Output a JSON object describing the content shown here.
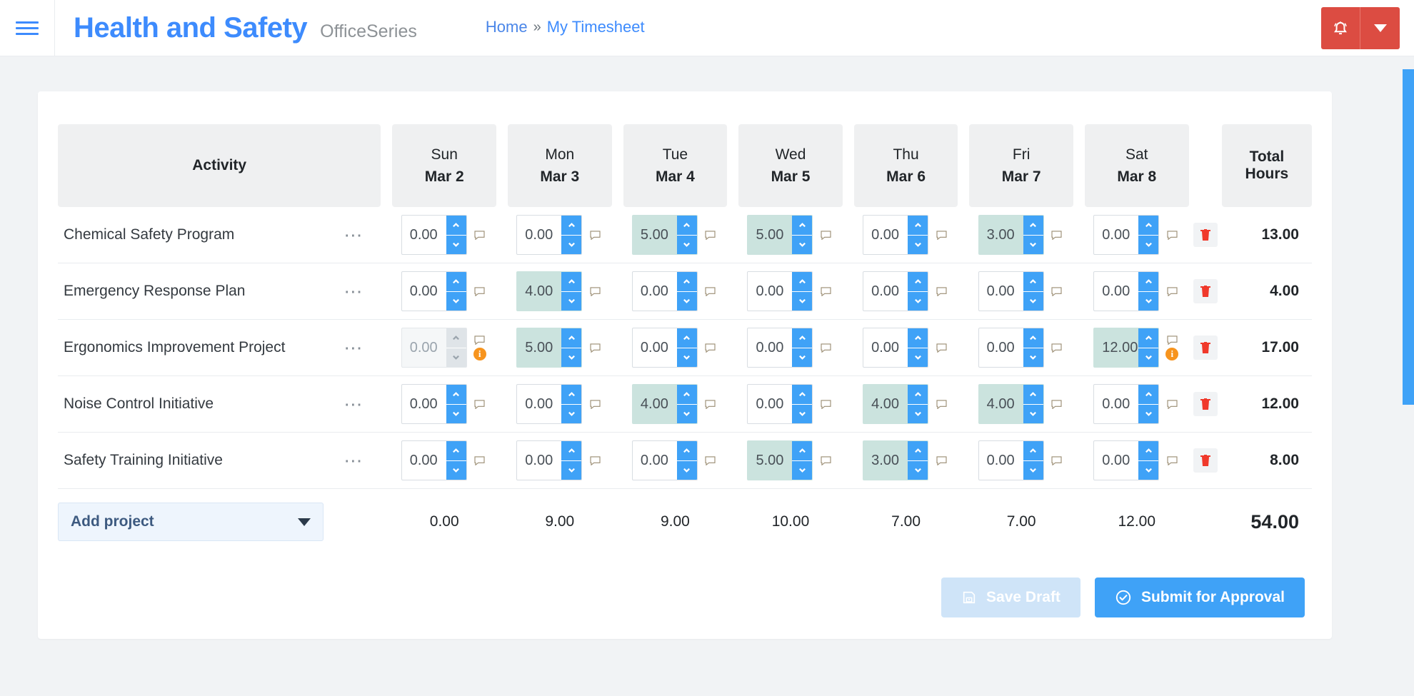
{
  "topbar": {
    "menu_icon": "hamburger-icon",
    "brand_title": "Health and Safety",
    "brand_subtitle": "OfficeSeries",
    "breadcrumb": {
      "home": "Home",
      "separator": "»",
      "current": "My Timesheet"
    },
    "notification_icon": "bell-icon",
    "dropdown_icon": "chevron-down-icon",
    "notification_color": "#dc4c42"
  },
  "colors": {
    "brand_blue": "#3d8bfd",
    "accent_blue": "#3fa2f7",
    "filled_cell": "#cbe3de",
    "warning_orange": "#f7941e",
    "delete_red": "#f0392b",
    "header_grey": "#eff0f1"
  },
  "table": {
    "activity_header": "Activity",
    "total_header": "Total Hours",
    "days": [
      {
        "dow": "Sun",
        "date": "Mar 2"
      },
      {
        "dow": "Mon",
        "date": "Mar 3"
      },
      {
        "dow": "Tue",
        "date": "Mar 4"
      },
      {
        "dow": "Wed",
        "date": "Mar 5"
      },
      {
        "dow": "Thu",
        "date": "Mar 6"
      },
      {
        "dow": "Fri",
        "date": "Mar 7"
      },
      {
        "dow": "Sat",
        "date": "Mar 8"
      }
    ],
    "row_menu_icon": "ellipsis-icon",
    "comment_icon": "comment-bubble-icon",
    "info_icon": "info-badge-icon",
    "delete_icon": "trash-icon",
    "rows": [
      {
        "activity": "Chemical Safety Program",
        "cells": [
          {
            "value": "0.00",
            "filled": false,
            "disabled": false,
            "info": false
          },
          {
            "value": "0.00",
            "filled": false,
            "disabled": false,
            "info": false
          },
          {
            "value": "5.00",
            "filled": true,
            "disabled": false,
            "info": false
          },
          {
            "value": "5.00",
            "filled": true,
            "disabled": false,
            "info": false
          },
          {
            "value": "0.00",
            "filled": false,
            "disabled": false,
            "info": false
          },
          {
            "value": "3.00",
            "filled": true,
            "disabled": false,
            "info": false
          },
          {
            "value": "0.00",
            "filled": false,
            "disabled": false,
            "info": false
          }
        ],
        "total": "13.00"
      },
      {
        "activity": "Emergency Response Plan",
        "cells": [
          {
            "value": "0.00",
            "filled": false,
            "disabled": false,
            "info": false
          },
          {
            "value": "4.00",
            "filled": true,
            "disabled": false,
            "info": false
          },
          {
            "value": "0.00",
            "filled": false,
            "disabled": false,
            "info": false
          },
          {
            "value": "0.00",
            "filled": false,
            "disabled": false,
            "info": false
          },
          {
            "value": "0.00",
            "filled": false,
            "disabled": false,
            "info": false
          },
          {
            "value": "0.00",
            "filled": false,
            "disabled": false,
            "info": false
          },
          {
            "value": "0.00",
            "filled": false,
            "disabled": false,
            "info": false
          }
        ],
        "total": "4.00"
      },
      {
        "activity": "Ergonomics Improvement Project",
        "cells": [
          {
            "value": "0.00",
            "filled": false,
            "disabled": true,
            "info": true
          },
          {
            "value": "5.00",
            "filled": true,
            "disabled": false,
            "info": false
          },
          {
            "value": "0.00",
            "filled": false,
            "disabled": false,
            "info": false
          },
          {
            "value": "0.00",
            "filled": false,
            "disabled": false,
            "info": false
          },
          {
            "value": "0.00",
            "filled": false,
            "disabled": false,
            "info": false
          },
          {
            "value": "0.00",
            "filled": false,
            "disabled": false,
            "info": false
          },
          {
            "value": "12.00",
            "filled": true,
            "disabled": false,
            "info": true
          }
        ],
        "total": "17.00"
      },
      {
        "activity": "Noise Control Initiative",
        "cells": [
          {
            "value": "0.00",
            "filled": false,
            "disabled": false,
            "info": false
          },
          {
            "value": "0.00",
            "filled": false,
            "disabled": false,
            "info": false
          },
          {
            "value": "4.00",
            "filled": true,
            "disabled": false,
            "info": false
          },
          {
            "value": "0.00",
            "filled": false,
            "disabled": false,
            "info": false
          },
          {
            "value": "4.00",
            "filled": true,
            "disabled": false,
            "info": false
          },
          {
            "value": "4.00",
            "filled": true,
            "disabled": false,
            "info": false
          },
          {
            "value": "0.00",
            "filled": false,
            "disabled": false,
            "info": false
          }
        ],
        "total": "12.00"
      },
      {
        "activity": "Safety Training Initiative",
        "cells": [
          {
            "value": "0.00",
            "filled": false,
            "disabled": false,
            "info": false
          },
          {
            "value": "0.00",
            "filled": false,
            "disabled": false,
            "info": false
          },
          {
            "value": "0.00",
            "filled": false,
            "disabled": false,
            "info": false
          },
          {
            "value": "5.00",
            "filled": true,
            "disabled": false,
            "info": false
          },
          {
            "value": "3.00",
            "filled": true,
            "disabled": false,
            "info": false
          },
          {
            "value": "0.00",
            "filled": false,
            "disabled": false,
            "info": false
          },
          {
            "value": "0.00",
            "filled": false,
            "disabled": false,
            "info": false
          }
        ],
        "total": "8.00"
      }
    ],
    "footer": {
      "add_project_label": "Add project",
      "add_project_caret": "chevron-down-icon",
      "day_totals": [
        "0.00",
        "9.00",
        "9.00",
        "10.00",
        "7.00",
        "7.00",
        "12.00"
      ],
      "grand_total": "54.00"
    }
  },
  "actions": {
    "save_draft_label": "Save Draft",
    "save_draft_icon": "save-floppy-icon",
    "save_draft_disabled": true,
    "submit_label": "Submit for Approval",
    "submit_icon": "check-circle-icon"
  }
}
